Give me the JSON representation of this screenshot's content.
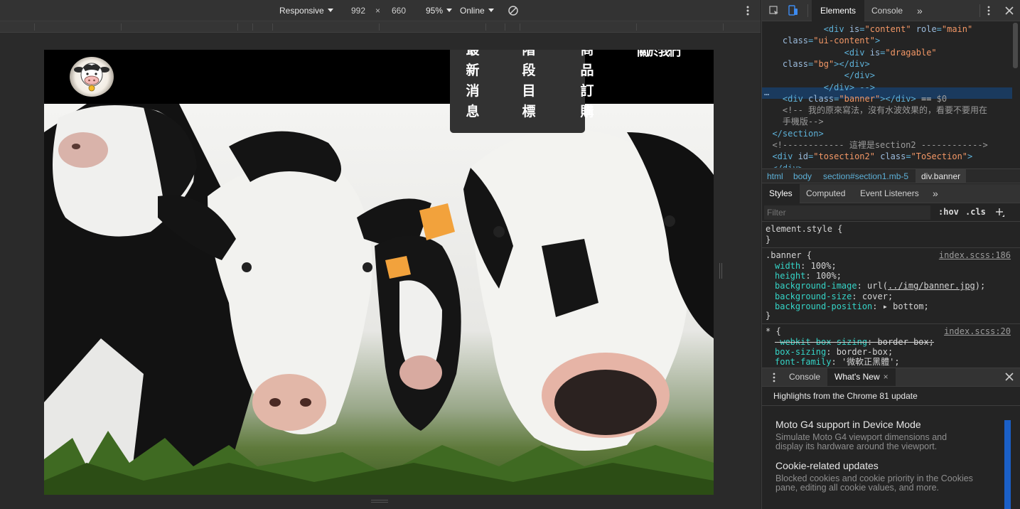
{
  "device_toolbar": {
    "device": "Responsive",
    "width": "992",
    "times": "×",
    "height": "660",
    "zoom": "95%",
    "network": "Online"
  },
  "site": {
    "nav": [
      {
        "chars": [
          "最",
          "新",
          "消",
          "息"
        ]
      },
      {
        "chars": [
          "階",
          "段",
          "目",
          "標"
        ]
      },
      {
        "chars": [
          "商",
          "品",
          "訂",
          "購"
        ]
      }
    ],
    "nav_more": "關於我們"
  },
  "devtools": {
    "tabs": {
      "elements": "Elements",
      "console": "Console",
      "more": "»"
    },
    "dom_lines": [
      {
        "indent": "            ",
        "parts": [
          {
            "c": "tag",
            "t": "<div "
          },
          {
            "c": "attr",
            "t": "is"
          },
          {
            "c": "tag",
            "t": "="
          },
          {
            "c": "val",
            "t": "\"content\""
          },
          {
            "c": "attr",
            "t": " role"
          },
          {
            "c": "tag",
            "t": "="
          },
          {
            "c": "val",
            "t": "\"main\""
          }
        ]
      },
      {
        "indent": "    ",
        "parts": [
          {
            "c": "attr",
            "t": "class"
          },
          {
            "c": "tag",
            "t": "="
          },
          {
            "c": "val",
            "t": "\"ui-content\""
          },
          {
            "c": "tag",
            "t": ">"
          }
        ]
      },
      {
        "indent": "                ",
        "parts": [
          {
            "c": "tag",
            "t": "<div "
          },
          {
            "c": "attr",
            "t": "is"
          },
          {
            "c": "tag",
            "t": "="
          },
          {
            "c": "val",
            "t": "\"dragable\""
          }
        ]
      },
      {
        "indent": "    ",
        "parts": [
          {
            "c": "attr",
            "t": "class"
          },
          {
            "c": "tag",
            "t": "="
          },
          {
            "c": "val",
            "t": "\"bg\""
          },
          {
            "c": "tag",
            "t": "></div>"
          }
        ]
      },
      {
        "indent": "                ",
        "parts": [
          {
            "c": "tag",
            "t": "</div>"
          }
        ]
      },
      {
        "indent": "            ",
        "parts": [
          {
            "c": "tag",
            "t": "</div> -->"
          }
        ]
      },
      {
        "indent": "    ",
        "parts": [
          {
            "c": "tag",
            "t": "<div "
          },
          {
            "c": "attr",
            "t": "class"
          },
          {
            "c": "tag",
            "t": "="
          },
          {
            "c": "val",
            "t": "\"banner\""
          },
          {
            "c": "tag",
            "t": "></div>"
          },
          {
            "c": "pval",
            "t": " == "
          },
          {
            "c": "cmt",
            "t": "$0"
          }
        ]
      },
      {
        "indent": "    ",
        "parts": [
          {
            "c": "cmt",
            "t": "<!-- 我的原來寫法，沒有水波效果的，看要不要用在"
          }
        ]
      },
      {
        "indent": "    ",
        "parts": [
          {
            "c": "cmt",
            "t": "手機版-->"
          }
        ]
      },
      {
        "indent": "  ",
        "parts": [
          {
            "c": "tag",
            "t": "</section>"
          }
        ]
      },
      {
        "indent": "  ",
        "parts": [
          {
            "c": "cmt",
            "t": "<!------------ 這裡是section2 ------------>"
          }
        ]
      },
      {
        "indent": "  ",
        "parts": [
          {
            "c": "tag",
            "t": "<div "
          },
          {
            "c": "attr",
            "t": "id"
          },
          {
            "c": "tag",
            "t": "="
          },
          {
            "c": "val",
            "t": "\"tosection2\""
          },
          {
            "c": "attr",
            "t": " class"
          },
          {
            "c": "tag",
            "t": "="
          },
          {
            "c": "val",
            "t": "\"ToSection\""
          },
          {
            "c": "tag",
            "t": ">"
          }
        ]
      },
      {
        "indent": "  ",
        "parts": [
          {
            "c": "tag",
            "t": "</div>"
          }
        ]
      }
    ],
    "breadcrumbs": [
      "html",
      "body",
      "section#section1.mb-5",
      "div.banner"
    ],
    "styles_tabs": {
      "styles": "Styles",
      "computed": "Computed",
      "listeners": "Event Listeners",
      "more": "»"
    },
    "filter_placeholder": "Filter",
    "hov": ":hov",
    "cls": ".cls",
    "element_style": "element.style {",
    "close_brace": "}",
    "banner_rule": {
      "selector": ".banner",
      "source": "index.scss:186",
      "props": [
        {
          "name": "width",
          "value": "100%;"
        },
        {
          "name": "height",
          "value": "100%;"
        },
        {
          "name": "background-image",
          "value": "url(",
          "url": "../img/banner.jpg",
          "tail": ");"
        },
        {
          "name": "background-size",
          "value": "cover;"
        },
        {
          "name": "background-position",
          "value": "▸ bottom;"
        }
      ]
    },
    "star_rule": {
      "selector": "*",
      "source": "index.scss:20",
      "props": [
        {
          "name": "-webkit-box-sizing",
          "value": "border-box;",
          "struck": true
        },
        {
          "name": "box-sizing",
          "value": "border-box;"
        },
        {
          "name": "font-family",
          "value": "'微軟正黑體';"
        }
      ]
    },
    "drawer": {
      "console_tab": "Console",
      "whats_new_tab": "What's New",
      "header": "Highlights from the Chrome 81 update",
      "items": [
        {
          "title": "Moto G4 support in Device Mode",
          "desc": "Simulate Moto G4 viewport dimensions and display its hardware around the viewport."
        },
        {
          "title": "Cookie-related updates",
          "desc": "Blocked cookies and cookie priority in the Cookies pane, editing all cookie values, and more."
        }
      ]
    }
  },
  "colors": {
    "selection": "#1a3a5e",
    "tag": "#5db0d7",
    "attr_value": "#f29766",
    "property": "#35d4c7",
    "accent": "#1a5fc7"
  }
}
